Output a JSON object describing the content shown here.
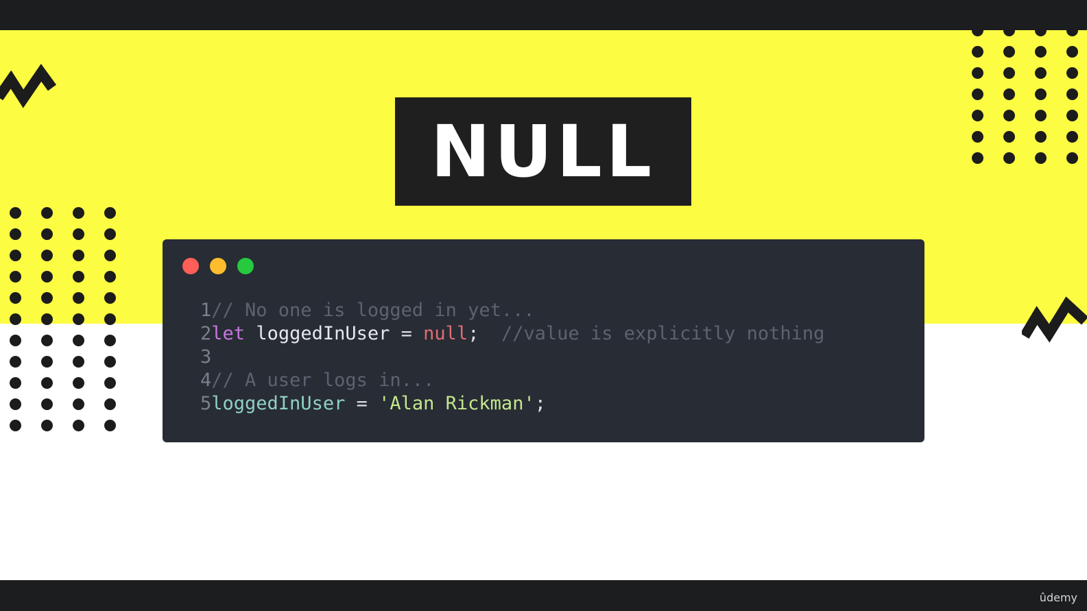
{
  "slide": {
    "title": "NULL",
    "colors": {
      "yellow": "#fcfc42",
      "title_bg": "#1f1f1f",
      "code_bg": "#282c34",
      "dot": "#1c1c1c"
    }
  },
  "code_window": {
    "traffic_lights": [
      {
        "name": "close",
        "color": "#ff5f56"
      },
      {
        "name": "minimize",
        "color": "#ffbd2e"
      },
      {
        "name": "maximize",
        "color": "#27c93f"
      }
    ],
    "lines": [
      {
        "number": "1",
        "tokens": [
          {
            "type": "comment",
            "text": "// No one is logged in yet..."
          }
        ]
      },
      {
        "number": "2",
        "tokens": [
          {
            "type": "keyword",
            "text": "let"
          },
          {
            "type": "plain",
            "text": " "
          },
          {
            "type": "var",
            "text": "loggedInUser"
          },
          {
            "type": "plain",
            "text": " = "
          },
          {
            "type": "null",
            "text": "null"
          },
          {
            "type": "plain",
            "text": ";  "
          },
          {
            "type": "comment",
            "text": "//value is explicitly nothing"
          }
        ]
      },
      {
        "number": "3",
        "tokens": []
      },
      {
        "number": "4",
        "tokens": [
          {
            "type": "comment",
            "text": "// A user logs in..."
          }
        ]
      },
      {
        "number": "5",
        "tokens": [
          {
            "type": "ident",
            "text": "loggedInUser"
          },
          {
            "type": "plain",
            "text": " = "
          },
          {
            "type": "string",
            "text": "'Alan Rickman'"
          },
          {
            "type": "plain",
            "text": ";"
          }
        ]
      }
    ]
  },
  "watermark": {
    "text": "ûdemy"
  }
}
